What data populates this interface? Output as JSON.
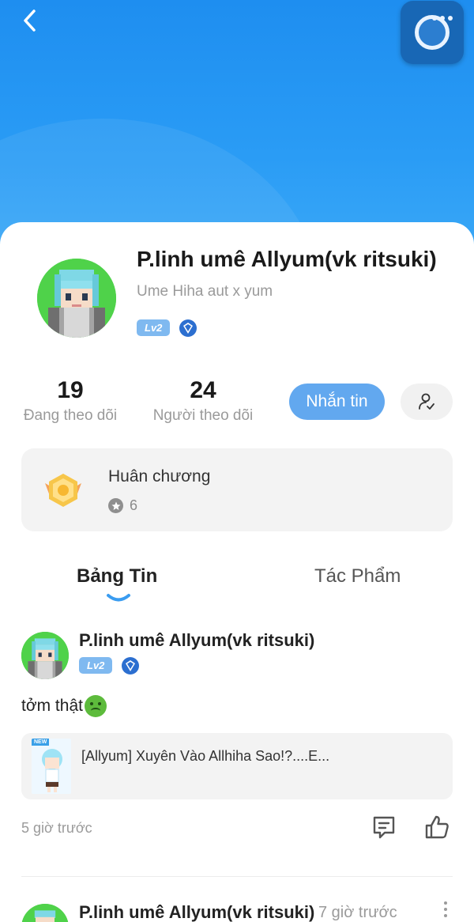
{
  "header": {
    "back_icon": "chevron-left-icon",
    "widget_icon": "floating-assistant-icon",
    "accent": "#2a9cf5"
  },
  "profile": {
    "name": "P.linh umê Allyum(vk ritsuki)",
    "bio": "Ume Hiha aut x yum",
    "level": "Lv2",
    "badge_icon": "shield-icon",
    "following_count": "19",
    "following_label": "Đang theo dõi",
    "followers_count": "24",
    "followers_label": "Người theo dõi",
    "message_button": "Nhắn tin",
    "follow_icon": "user-check-icon"
  },
  "medals": {
    "title": "Huân chương",
    "count": "6",
    "icon": "medal-icon"
  },
  "tabs": [
    {
      "label": "Bảng Tin",
      "active": true
    },
    {
      "label": "Tác Phẩm",
      "active": false
    }
  ],
  "posts": [
    {
      "author": "P.linh umê Allyum(vk ritsuki)",
      "level": "Lv2",
      "text": "tởm thật",
      "emoji": "nauseated-face-icon",
      "attachment": {
        "badge": "NEW",
        "title": "[Allyum] Xuyên Vào Allhiha Sao!?....E..."
      },
      "time": "5 giờ trước",
      "comment_icon": "comment-icon",
      "like_icon": "thumbs-up-icon"
    },
    {
      "author": "P.linh umê Allyum(vk ritsuki)",
      "time": "7 giờ trước",
      "more_icon": "more-vertical-icon"
    }
  ]
}
